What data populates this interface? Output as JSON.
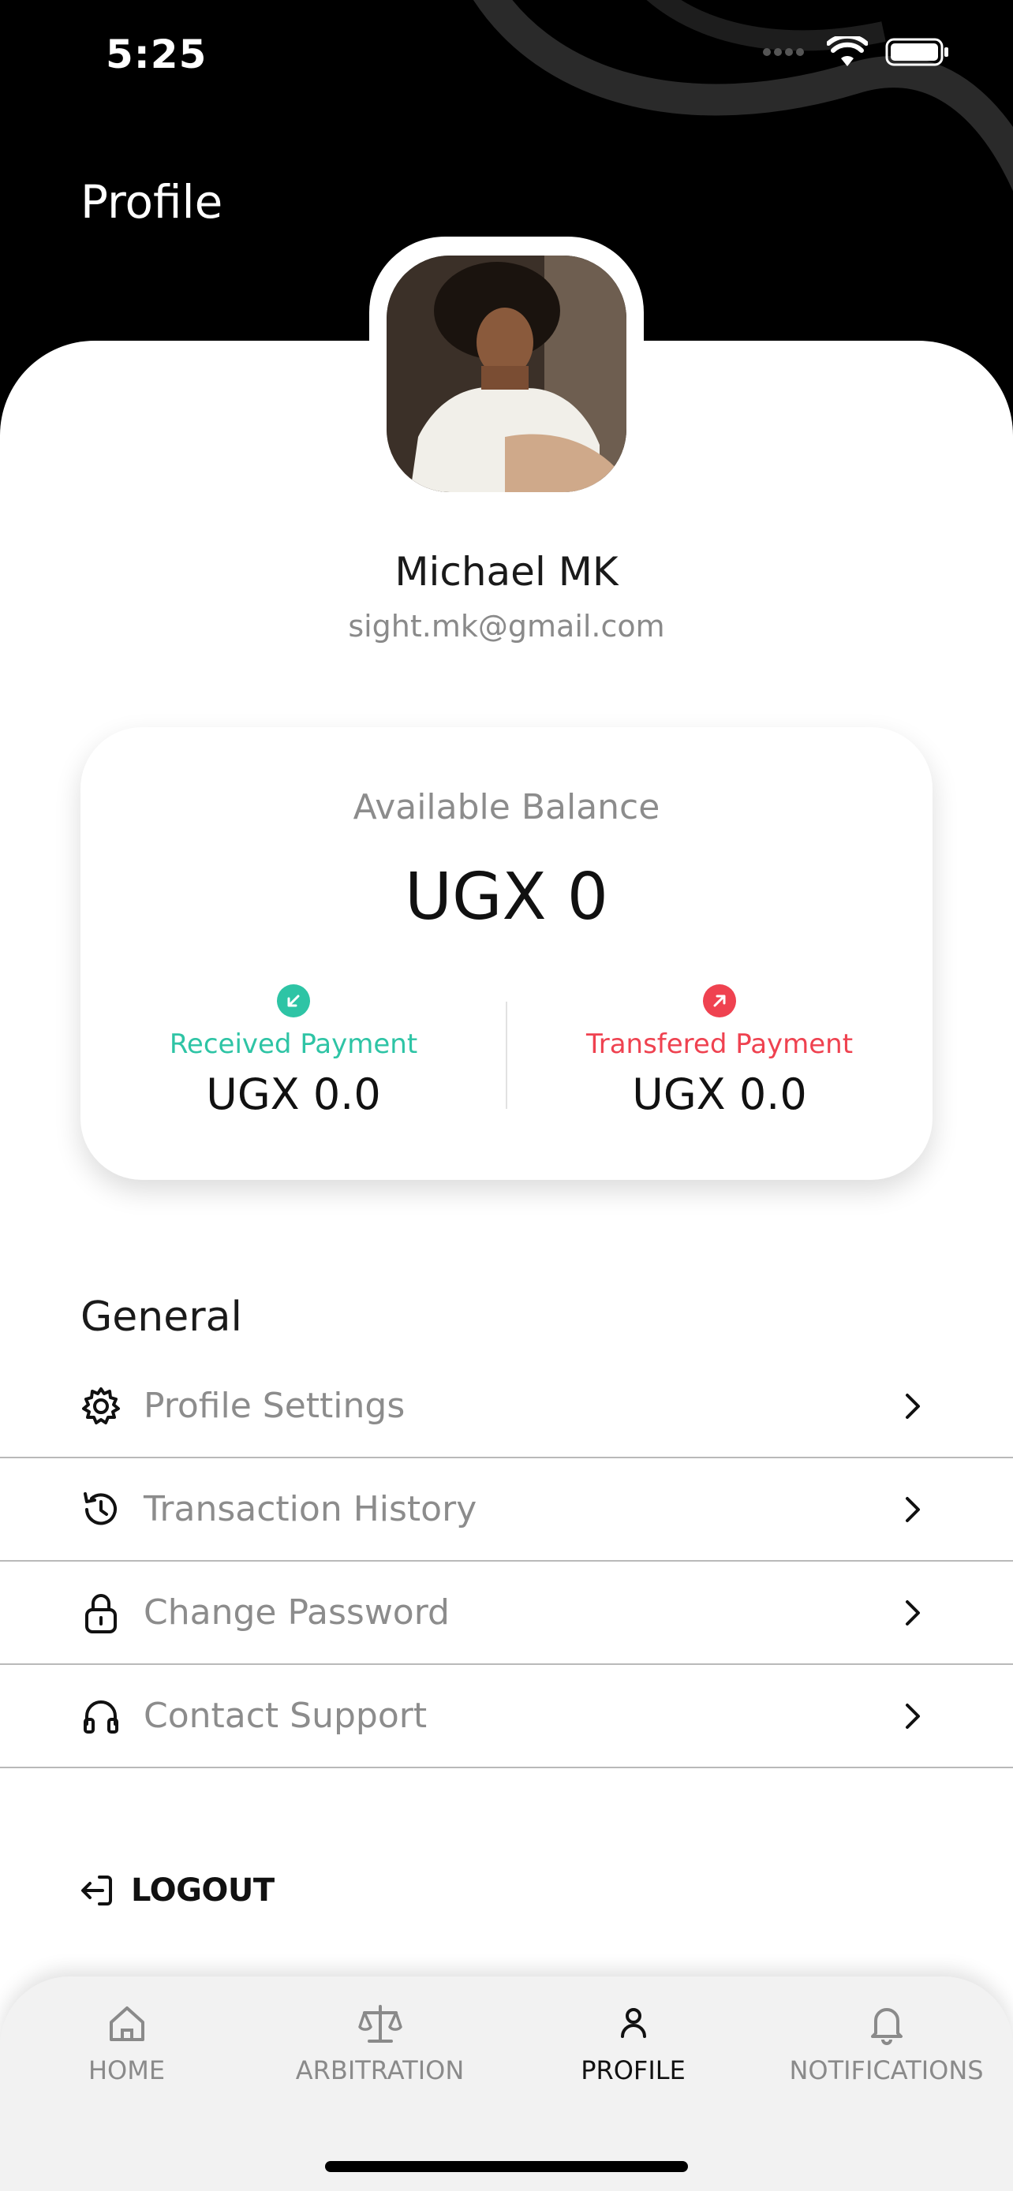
{
  "status_bar": {
    "time": "5:25"
  },
  "header": {
    "title": "Profile"
  },
  "user": {
    "name": "Michael MK",
    "email": "sight.mk@gmail.com"
  },
  "balance": {
    "label": "Available Balance",
    "value": "UGX 0",
    "received": {
      "label": "Received Payment",
      "value": "UGX 0.0",
      "color": "#2ec4a5"
    },
    "transferred": {
      "label": "Transfered Payment",
      "value": "UGX 0.0",
      "color": "#ef4250"
    }
  },
  "general": {
    "title": "General",
    "items": [
      {
        "label": "Profile Settings",
        "icon": "gear-icon"
      },
      {
        "label": "Transaction History",
        "icon": "history-icon"
      },
      {
        "label": "Change Password",
        "icon": "lock-icon"
      },
      {
        "label": "Contact Support",
        "icon": "headphones-icon"
      }
    ]
  },
  "logout": {
    "label": "LOGOUT"
  },
  "tabbar": {
    "tabs": [
      {
        "label": "HOME",
        "icon": "home-icon"
      },
      {
        "label": "ARBITRATION",
        "icon": "scales-icon"
      },
      {
        "label": "PROFILE",
        "icon": "person-icon",
        "active": true
      },
      {
        "label": "NOTIFICATIONS",
        "icon": "bell-icon"
      }
    ]
  }
}
